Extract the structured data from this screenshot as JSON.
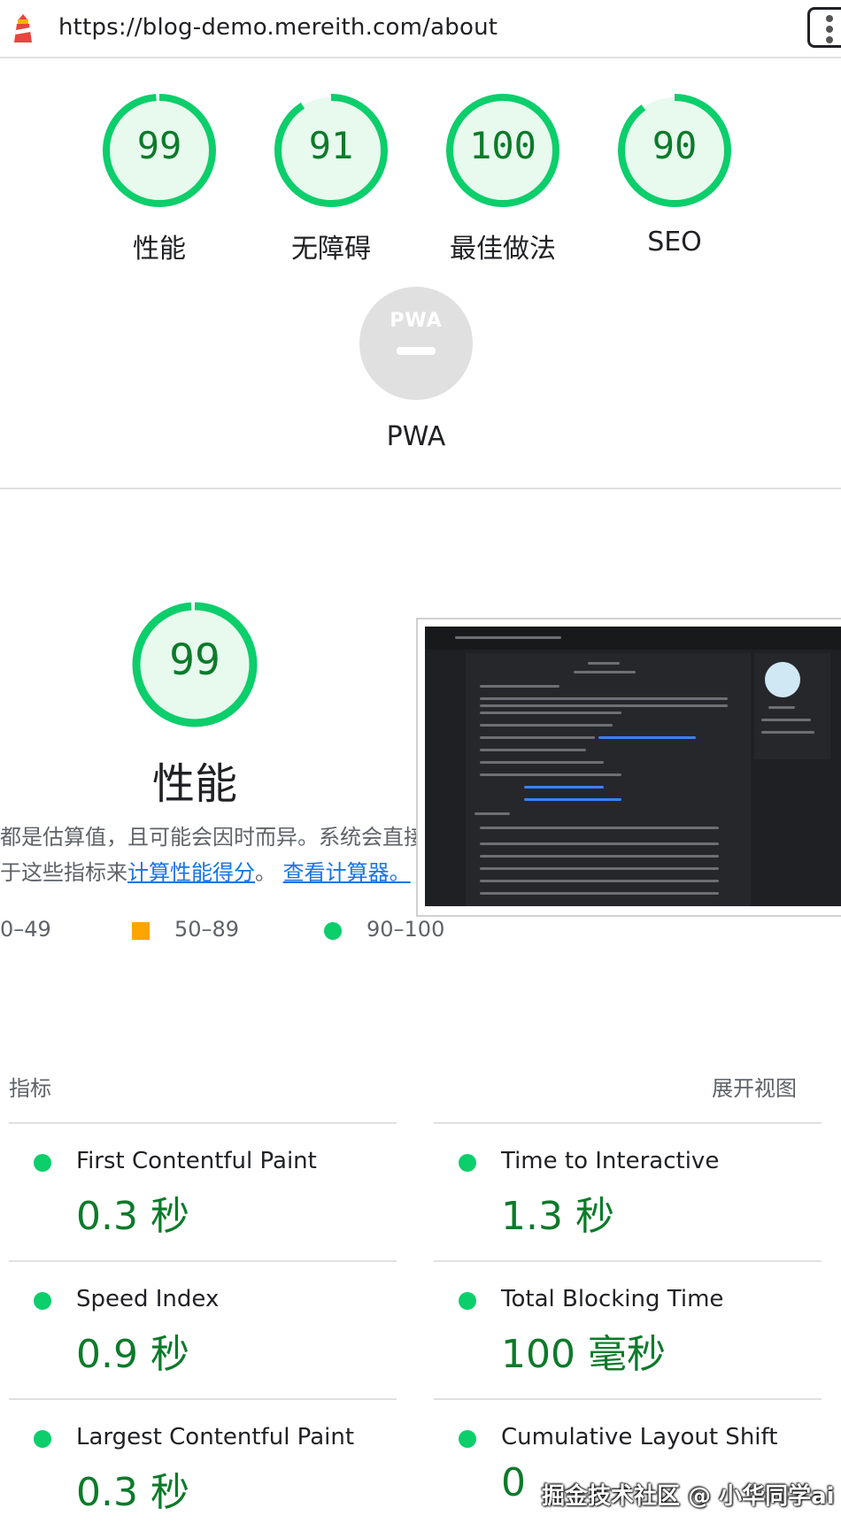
{
  "browser": {
    "url": "https://blog-demo.mereith.com/about",
    "menu_icon": "kebab-menu-icon",
    "site_icon": "lighthouse-icon"
  },
  "colors": {
    "pass": "#0cce6b",
    "pass_text": "#0c7a2a",
    "average": "#ffa400",
    "link": "#1a73e8",
    "pwa_gray": "#e0e0e0"
  },
  "categories": [
    {
      "score": 99,
      "label": "性能"
    },
    {
      "score": 91,
      "label": "无障碍"
    },
    {
      "score": 100,
      "label": "最佳做法"
    },
    {
      "score": 90,
      "label": "SEO"
    }
  ],
  "pwa": {
    "badge": "PWA",
    "dash": "—",
    "label": "PWA"
  },
  "performance": {
    "score": 99,
    "title": "性能",
    "desc_line1": "都是估算值，且可能会因时而异。系统会直接基",
    "desc_line2_prefix": "于这些指标来",
    "link_calc": "计算性能得分",
    "desc_line2_sep": "。",
    "link_view": "查看计算器。",
    "legend": {
      "fail": "0–49",
      "average": "50–89",
      "pass": "90–100"
    }
  },
  "metrics": {
    "heading": "指标",
    "toggle": "展开视图",
    "items": [
      {
        "title": "First Contentful Paint",
        "value": "0.3 秒"
      },
      {
        "title": "Time to Interactive",
        "value": "1.3 秒"
      },
      {
        "title": "Speed Index",
        "value": "0.9 秒"
      },
      {
        "title": "Total Blocking Time",
        "value": "100 毫秒"
      },
      {
        "title": "Largest Contentful Paint",
        "value": "0.3 秒"
      },
      {
        "title": "Cumulative Layout Shift",
        "value": "0"
      }
    ]
  },
  "watermark": "掘金技术社区 @ 小华同学ai"
}
